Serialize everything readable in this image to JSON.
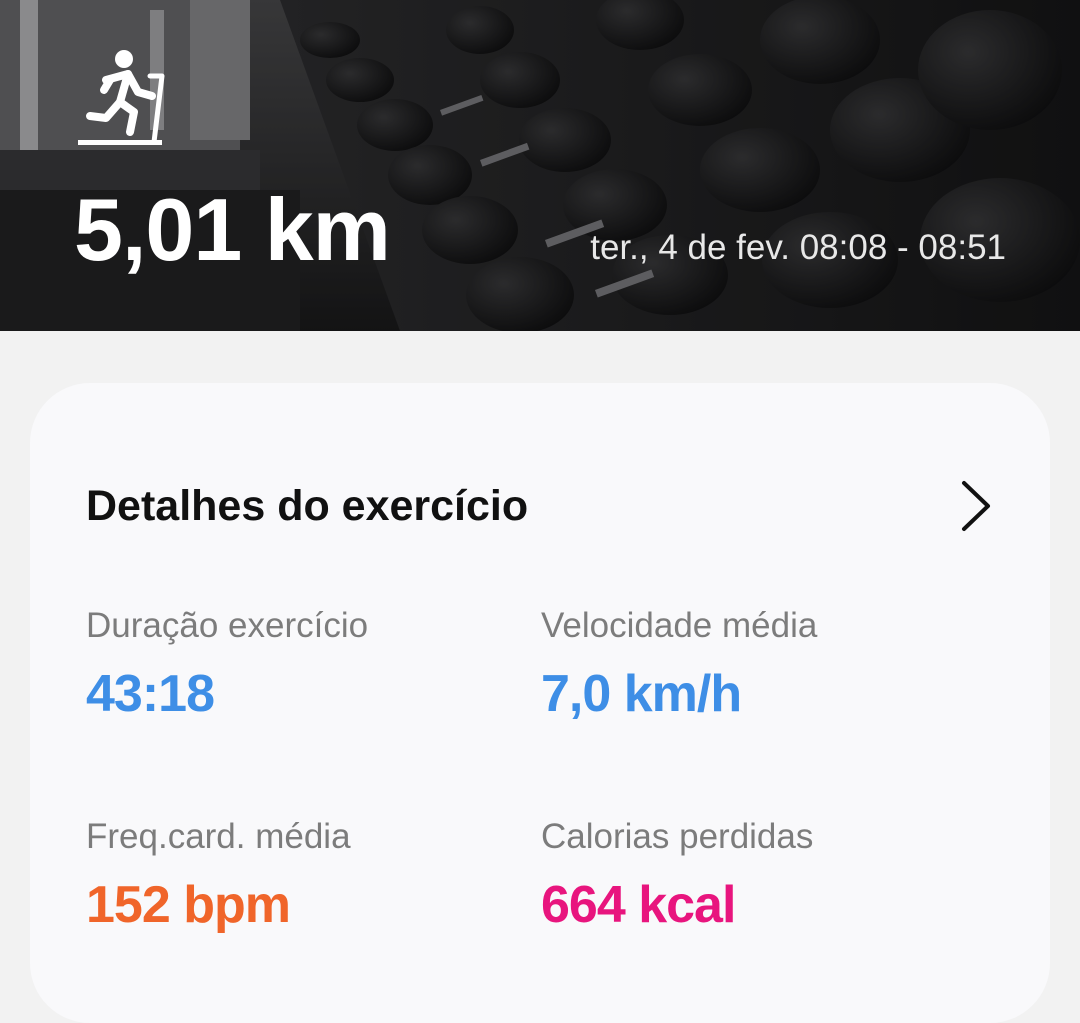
{
  "header": {
    "activity_icon": "treadmill-running-icon",
    "distance": "5,01 km",
    "date_range": "ter., 4 de fev. 08:08 - 08:51"
  },
  "details": {
    "title": "Detalhes do exercício",
    "chevron_icon": "chevron-right-icon",
    "stats": [
      {
        "label": "Duração exercício",
        "value": "43:18",
        "color": "#3e8ee6"
      },
      {
        "label": "Velocidade média",
        "value": "7,0 km/h",
        "color": "#3e8ee6"
      },
      {
        "label": "Freq.card. média",
        "value": "152 bpm",
        "color": "#f0652a"
      },
      {
        "label": "Calorias perdidas",
        "value": "664 kcal",
        "color": "#e8157e"
      }
    ]
  }
}
